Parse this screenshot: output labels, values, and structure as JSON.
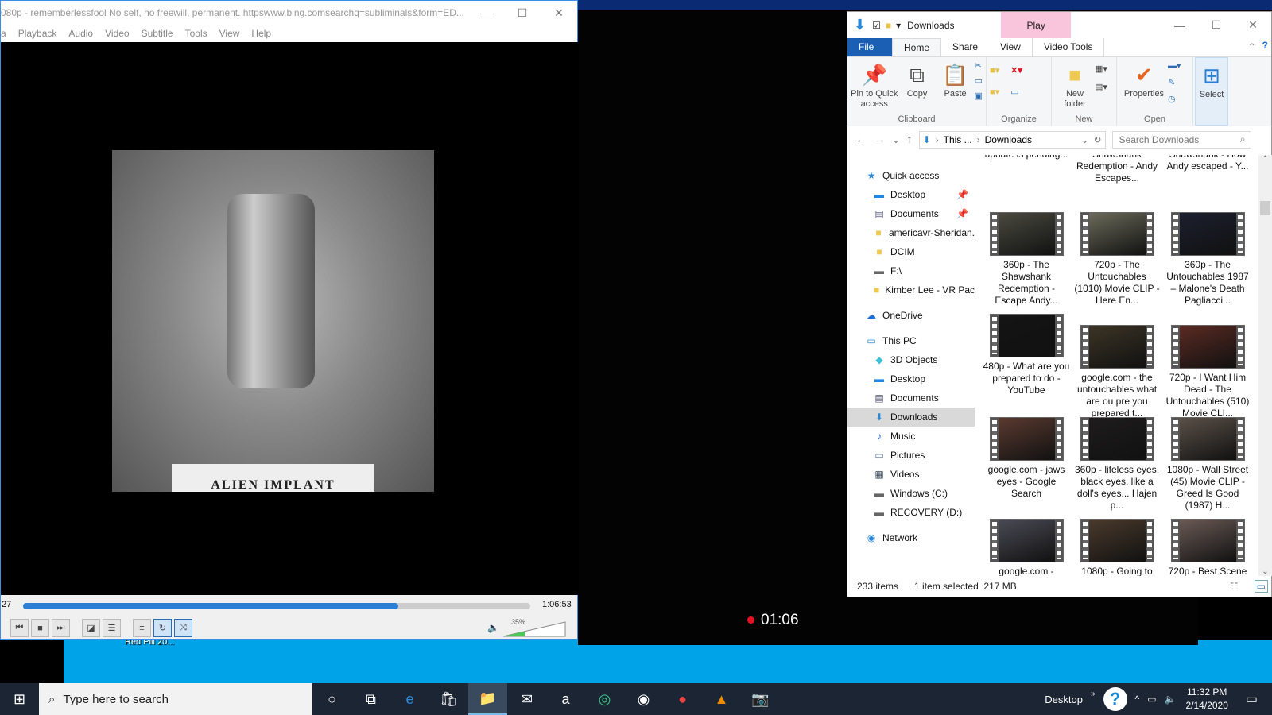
{
  "vlc": {
    "title": "080p - rememberlessfool No self, no freewill, permanent. httpswww.bing.comsearchq=subliminals&form=ED...",
    "menu": [
      "a",
      "Playback",
      "Audio",
      "Video",
      "Subtitle",
      "Tools",
      "View",
      "Help"
    ],
    "video_caption": "ALIEN IMPLANT",
    "elapsed": "27",
    "duration": "1:06:53",
    "progress_percent": 74,
    "volume_label": "35%",
    "volume_percent": 35,
    "below_label": "Red Pill 20..."
  },
  "recorder": {
    "time": "01:06",
    "color": "#e81123"
  },
  "explorer": {
    "title": "Downloads",
    "context_tab": "Play",
    "tabs": [
      "File",
      "Home",
      "Share",
      "View",
      "Video Tools"
    ],
    "ribbon": {
      "pin": "Pin to Quick access",
      "copy": "Copy",
      "paste": "Paste",
      "new_folder": "New folder",
      "properties": "Properties",
      "select": "Select",
      "groups": [
        "Clipboard",
        "Organize",
        "New",
        "Open"
      ]
    },
    "address": {
      "crumbs": [
        "This ...",
        "Downloads"
      ],
      "search_placeholder": "Search Downloads"
    },
    "nav": [
      {
        "label": "Quick access",
        "icon": "star-icon",
        "level": 0
      },
      {
        "label": "Desktop",
        "icon": "desktop-icon",
        "level": 1,
        "pinned": true
      },
      {
        "label": "Documents",
        "icon": "documents-icon",
        "level": 1,
        "pinned": true
      },
      {
        "label": "americavr-Sheridan.",
        "icon": "folder-icon",
        "level": 1
      },
      {
        "label": "DCIM",
        "icon": "folder-icon",
        "level": 1
      },
      {
        "label": "F:\\",
        "icon": "drive-icon",
        "level": 1
      },
      {
        "label": "Kimber Lee - VR Pac",
        "icon": "folder-icon",
        "level": 1
      },
      {
        "label": "OneDrive",
        "icon": "cloud-icon",
        "level": 0
      },
      {
        "label": "This PC",
        "icon": "computer-icon",
        "level": 0
      },
      {
        "label": "3D Objects",
        "icon": "cube-icon",
        "level": 1
      },
      {
        "label": "Desktop",
        "icon": "desktop-icon",
        "level": 1
      },
      {
        "label": "Documents",
        "icon": "documents-icon",
        "level": 1
      },
      {
        "label": "Downloads",
        "icon": "download-icon",
        "level": 1,
        "selected": true
      },
      {
        "label": "Music",
        "icon": "music-icon",
        "level": 1
      },
      {
        "label": "Pictures",
        "icon": "pictures-icon",
        "level": 1
      },
      {
        "label": "Videos",
        "icon": "videos-icon",
        "level": 1
      },
      {
        "label": "Windows (C:)",
        "icon": "drive-icon",
        "level": 1
      },
      {
        "label": "RECOVERY (D:)",
        "icon": "drive-icon",
        "level": 1
      },
      {
        "label": "Network",
        "icon": "network-icon",
        "level": 0
      }
    ],
    "files": [
      {
        "name": "update is pending...",
        "thumb": false
      },
      {
        "name": "Shawshank Redemption - Andy Escapes...",
        "thumb": false
      },
      {
        "name": "Shawshank - How Andy escaped - Y...",
        "thumb": false
      },
      {
        "name": "360p - The Shawshank Redemption - Escape Andy...",
        "thumb": true,
        "tone": "#4a4a40"
      },
      {
        "name": "720p - The Untouchables (1010) Movie CLIP - Here En...",
        "thumb": true,
        "tone": "#6b6a5a"
      },
      {
        "name": "360p - The Untouchables 1987 – Malone's Death Pagliacci...",
        "thumb": true,
        "tone": "#1c1f2e"
      },
      {
        "name": "480p - What are you prepared to do - YouTube",
        "thumb": true,
        "tone": "#141414"
      },
      {
        "name": "google.com - the untouchables what are ou pre you prepared t...",
        "thumb": true,
        "tone": "#3c3426"
      },
      {
        "name": "720p - I Want Him Dead - The Untouchables (510) Movie CLI...",
        "thumb": true,
        "tone": "#5a2a22"
      },
      {
        "name": "google.com - jaws eyes - Google Search",
        "thumb": true,
        "tone": "#5a3a30"
      },
      {
        "name": "360p - lifeless eyes, black eyes, like a doll's eyes... Hajen p...",
        "thumb": true,
        "tone": "#1e1c1c"
      },
      {
        "name": "1080p - Wall Street (45) Movie CLIP - Greed Is Good (1987) H...",
        "thumb": true,
        "tone": "#5a5048"
      },
      {
        "name": "google.com -",
        "thumb": true,
        "tone": "#4a4a55"
      },
      {
        "name": "1080p - Going to",
        "thumb": true,
        "tone": "#4a3a2c"
      },
      {
        "name": "720p - Best Scene",
        "thumb": true,
        "tone": "#6a5a55"
      }
    ],
    "status": {
      "count": "233 items",
      "selected": "1 item selected",
      "size": "217 MB"
    }
  },
  "taskbar": {
    "search_placeholder": "Type here to search",
    "desktop_label": "Desktop",
    "time": "11:32 PM",
    "date": "2/14/2020",
    "apps": [
      "cortana-icon",
      "task-view-icon",
      "edge-icon",
      "store-icon",
      "file-explorer-icon",
      "mail-icon",
      "amazon-icon",
      "tripadvisor-icon",
      "camera-app-icon",
      "chrome-icon",
      "vlc-icon",
      "screenshot-icon"
    ]
  }
}
